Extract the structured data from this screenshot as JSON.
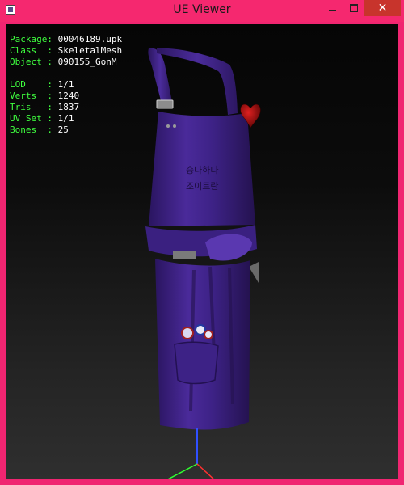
{
  "window": {
    "title": "UE Viewer"
  },
  "title_bar": {
    "close_glyph": "✕"
  },
  "mesh_info": [
    {
      "key": "Package: ",
      "value": "00046189.upk"
    },
    {
      "key": "Class  : ",
      "value": "SkeletalMesh"
    },
    {
      "key": "Object : ",
      "value": "090155_GonM"
    },
    {
      "key": "LOD    : ",
      "value": "1/1"
    },
    {
      "key": "Verts  : ",
      "value": "1240"
    },
    {
      "key": "Tris   : ",
      "value": "1837"
    },
    {
      "key": "UV Set : ",
      "value": "1/1"
    },
    {
      "key": "Bones  : ",
      "value": "25"
    }
  ],
  "model": {
    "apron_color": "#4a2a9a",
    "embroidery": [
      "승나하다",
      "조이트란"
    ]
  },
  "axes": {
    "x_color": "#ff3030",
    "y_color": "#30ff30",
    "z_color": "#3050ff"
  },
  "icons": {
    "app": "app-icon",
    "minimize": "minimize-icon",
    "maximize": "maximize-icon",
    "close": "close-icon"
  }
}
